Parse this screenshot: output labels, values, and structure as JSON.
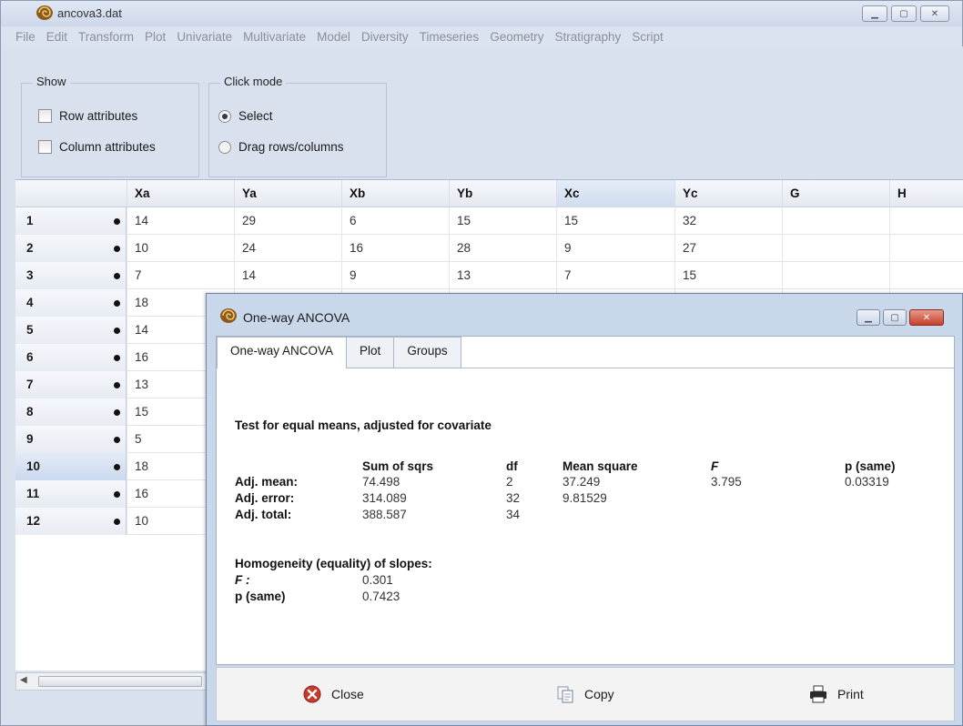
{
  "window": {
    "title": "ancova3.dat"
  },
  "menu": [
    "File",
    "Edit",
    "Transform",
    "Plot",
    "Univariate",
    "Multivariate",
    "Model",
    "Diversity",
    "Timeseries",
    "Geometry",
    "Stratigraphy",
    "Script"
  ],
  "show_group": {
    "title": "Show",
    "options": [
      {
        "label": "Row attributes",
        "checked": false
      },
      {
        "label": "Column attributes",
        "checked": false
      }
    ]
  },
  "click_mode": {
    "title": "Click mode",
    "options": [
      {
        "label": "Select",
        "selected": true
      },
      {
        "label": "Drag rows/columns",
        "selected": false
      }
    ]
  },
  "grid": {
    "columns": [
      "Xa",
      "Ya",
      "Xb",
      "Yb",
      "Xc",
      "Yc",
      "G",
      "H"
    ],
    "selected_column": "Xc",
    "selected_row": "10",
    "rows": [
      {
        "id": "1",
        "cells": [
          "14",
          "29",
          "6",
          "15",
          "15",
          "32",
          "",
          ""
        ]
      },
      {
        "id": "2",
        "cells": [
          "10",
          "24",
          "16",
          "28",
          "9",
          "27",
          "",
          ""
        ]
      },
      {
        "id": "3",
        "cells": [
          "7",
          "14",
          "9",
          "13",
          "7",
          "15",
          "",
          ""
        ]
      },
      {
        "id": "4",
        "cells": [
          "18"
        ]
      },
      {
        "id": "5",
        "cells": [
          "14"
        ]
      },
      {
        "id": "6",
        "cells": [
          "16"
        ]
      },
      {
        "id": "7",
        "cells": [
          "13"
        ]
      },
      {
        "id": "8",
        "cells": [
          "15"
        ]
      },
      {
        "id": "9",
        "cells": [
          "5"
        ]
      },
      {
        "id": "10",
        "cells": [
          "18"
        ]
      },
      {
        "id": "11",
        "cells": [
          "16"
        ]
      },
      {
        "id": "12",
        "cells": [
          "10"
        ]
      }
    ]
  },
  "dialog": {
    "title": "One-way ANCOVA",
    "tabs": [
      "One-way ANCOVA",
      "Plot",
      "Groups"
    ],
    "active_tab": "One-way ANCOVA",
    "heading": "Test for equal means, adjusted for covariate",
    "table_headers": [
      "Sum of sqrs",
      "df",
      "Mean square",
      "F",
      "p  (same)"
    ],
    "table_rows": [
      {
        "label": "Adj. mean:",
        "sum_sqrs": "74.498",
        "df": "2",
        "mean_square": "37.249",
        "F": "3.795",
        "p": "0.03319"
      },
      {
        "label": "Adj. error:",
        "sum_sqrs": "314.089",
        "df": "32",
        "mean_square": "9.81529",
        "F": "",
        "p": ""
      },
      {
        "label": "Adj. total:",
        "sum_sqrs": "388.587",
        "df": "34",
        "mean_square": "",
        "F": "",
        "p": ""
      }
    ],
    "homogeneity": {
      "heading": "Homogeneity (equality) of slopes:",
      "F_label": "F  :",
      "F_value": "0.301",
      "p_label": "p  (same)",
      "p_value": "0.7423"
    },
    "buttons": {
      "close": "Close",
      "copy": "Copy",
      "print": "Print"
    }
  }
}
